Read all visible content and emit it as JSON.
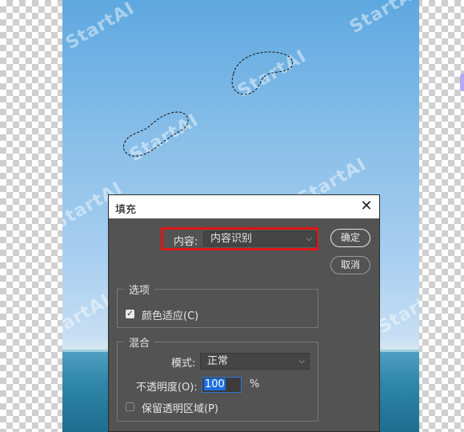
{
  "canvas": {
    "watermark_text": "StartAI"
  },
  "dialog": {
    "title": "填充",
    "content_label": "内容:",
    "content_value": "内容识别",
    "ok_label": "确定",
    "cancel_label": "取消",
    "options_group": {
      "title": "选项",
      "color_adapt_label": "颜色适应(C)",
      "color_adapt_checked": true
    },
    "blend_group": {
      "title": "混合",
      "mode_label": "模式:",
      "mode_value": "正常",
      "opacity_label": "不透明度(O):",
      "opacity_value": "100",
      "opacity_unit": "%",
      "preserve_transparency_label": "保留透明区域(P)",
      "preserve_transparency_checked": false
    }
  },
  "colors": {
    "dialog_bg": "#535353",
    "highlight_border": "#e01515",
    "selection_blue": "#1e6fe0"
  }
}
